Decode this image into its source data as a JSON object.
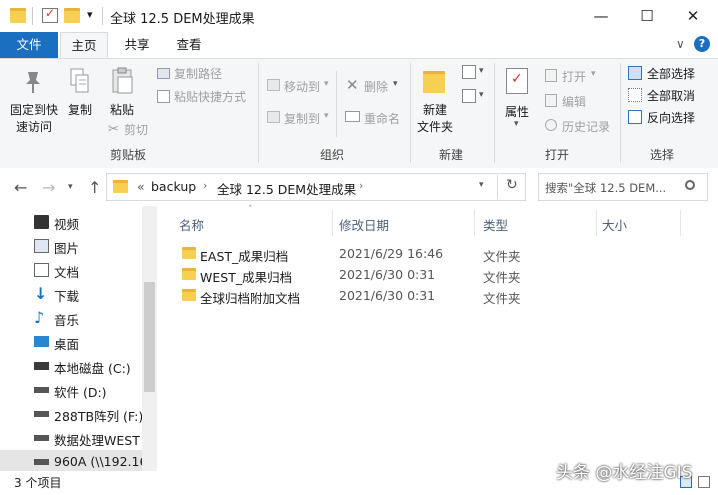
{
  "window": {
    "title": "全球 12.5 DEM处理成果",
    "minimize": "—",
    "maximize": "☐",
    "close": "✕",
    "quick_access_dropdown": "▾"
  },
  "menu": {
    "file": "文件",
    "home": "主页",
    "share": "共享",
    "view": "查看",
    "collapse": "∨",
    "help": "?"
  },
  "ribbon": {
    "clipboard": {
      "group_label": "剪贴板",
      "pin_line1": "固定到快",
      "pin_line2": "速访问",
      "copy": "复制",
      "paste": "粘贴",
      "copy_path": "复制路径",
      "paste_shortcut": "粘贴快捷方式",
      "cut": "剪切"
    },
    "organize": {
      "group_label": "组织",
      "move_to": "移动到",
      "copy_to": "复制到",
      "delete": "删除",
      "rename": "重命名"
    },
    "new": {
      "group_label": "新建",
      "new_folder_line1": "新建",
      "new_folder_line2": "文件夹"
    },
    "open": {
      "group_label": "打开",
      "properties": "属性",
      "open": "打开",
      "edit": "编辑",
      "history": "历史记录"
    },
    "select": {
      "group_label": "选择",
      "select_all": "全部选择",
      "select_none": "全部取消",
      "invert": "反向选择"
    }
  },
  "address": {
    "prefix": "«",
    "crumb1": "backup",
    "crumb2": "全球 12.5 DEM处理成果",
    "search_placeholder": "搜索\"全球 12.5 DEM..."
  },
  "nav_pane": {
    "items": [
      {
        "label": "视频"
      },
      {
        "label": "图片"
      },
      {
        "label": "文档"
      },
      {
        "label": "下载"
      },
      {
        "label": "音乐"
      },
      {
        "label": "桌面"
      },
      {
        "label": "本地磁盘 (C:)"
      },
      {
        "label": "软件 (D:)"
      },
      {
        "label": "288TB阵列 (F:)"
      },
      {
        "label": "数据处理WEST"
      },
      {
        "label": "960A (\\\\192.16"
      }
    ]
  },
  "columns": {
    "name": "名称",
    "modified": "修改日期",
    "type": "类型",
    "size": "大小"
  },
  "files": [
    {
      "name": "EAST_成果归档",
      "modified": "2021/6/29 16:46",
      "type": "文件夹"
    },
    {
      "name": "WEST_成果归档",
      "modified": "2021/6/30 0:31",
      "type": "文件夹"
    },
    {
      "name": "全球归档附加文档",
      "modified": "2021/6/30 0:31",
      "type": "文件夹"
    }
  ],
  "status": {
    "count": "3 个项目"
  },
  "watermark": "头条 @水经注GIS",
  "colors": {
    "accent": "#1a6fc1",
    "folder": "#f7cf53",
    "header_text": "#4c607a"
  }
}
